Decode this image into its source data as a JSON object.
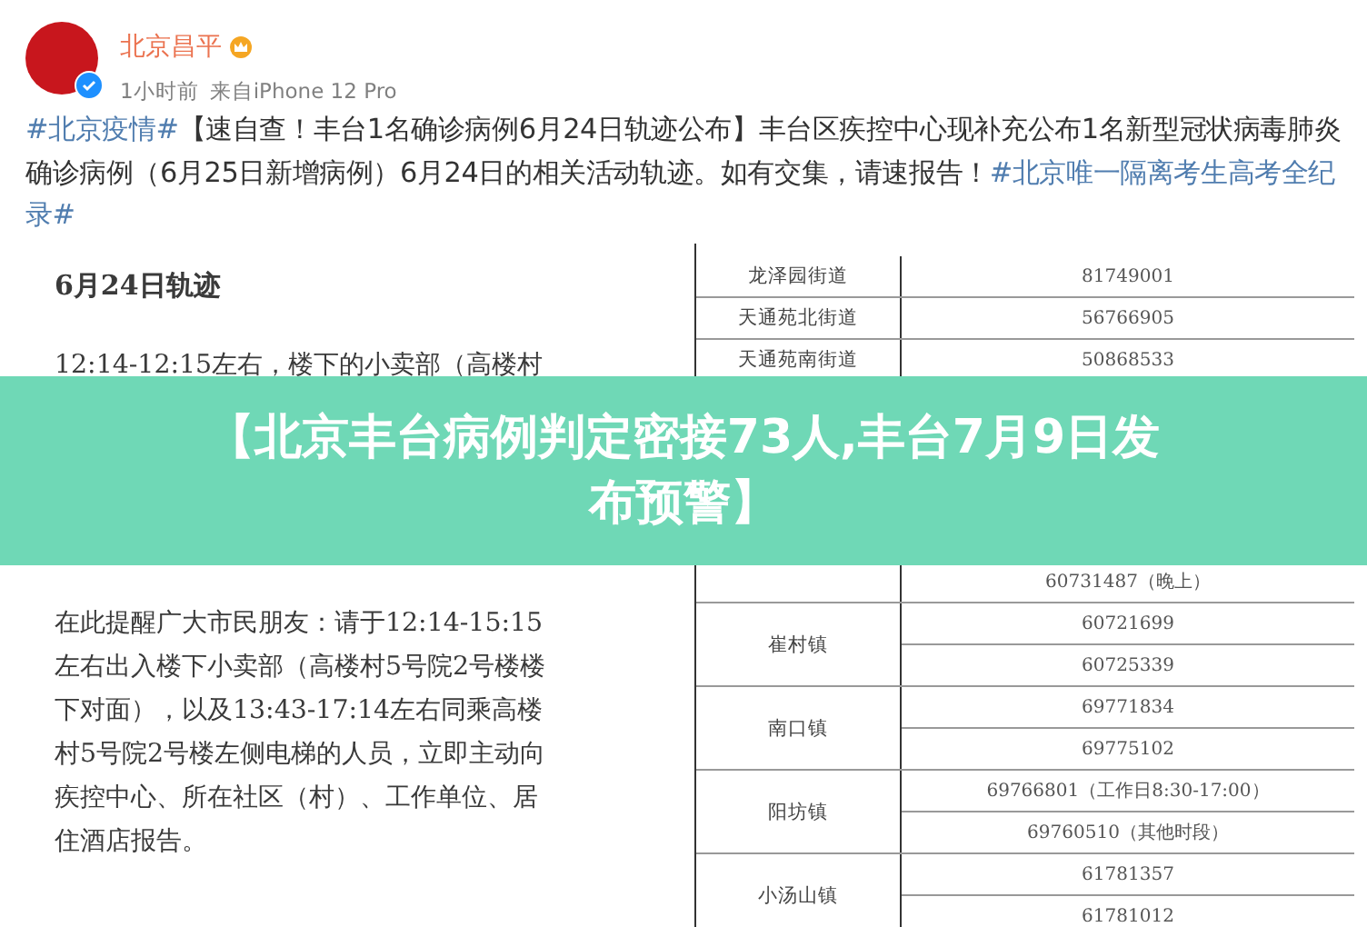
{
  "post": {
    "author": "北京昌平",
    "verified": true,
    "time": "1小时前",
    "source": "来自iPhone 12 Pro",
    "body": [
      {
        "kind": "tag",
        "text": "#北京疫情#"
      },
      {
        "kind": "text",
        "text": "【速自查！丰台1名确诊病例6月24日轨迹公布】丰台区疾控中心现补充公布1名新型冠状病毒肺炎确诊病例（6月25日新增病例）6月24日的相关活动轨迹。如有交集，请速报告！"
      },
      {
        "kind": "tag",
        "text": "#北京唯一隔离考生高考全纪录#"
      }
    ]
  },
  "document": {
    "title": "6月24日轨迹",
    "paragraphs": [
      [
        "12:14-12:15左右，楼下的小卖部（高楼村"
      ],
      [
        "在此提醒广大市民朋友：请于12:14-15:15",
        "左右出入楼下小卖部（高楼村5号院2号楼楼",
        "下对面），以及13:43-17:14左右同乘高楼",
        "村5号院2号楼左侧电梯的人员，立即主动向",
        "疾控中心、所在社区（村）、工作单位、居",
        "住酒店报告。"
      ]
    ]
  },
  "contacts": {
    "rows": [
      {
        "name": "龙泽园街道",
        "numbers": [
          "81749001"
        ]
      },
      {
        "name": "天通苑北街道",
        "numbers": [
          "56766905"
        ]
      },
      {
        "name": "天通苑南街道",
        "numbers": [
          "50868533"
        ]
      },
      {
        "numbers": [
          "60731487（晚上）"
        ]
      },
      {
        "name": "崔村镇",
        "numbers": [
          "60721699",
          "60725339"
        ]
      },
      {
        "name": "南口镇",
        "numbers": [
          "69771834",
          "69775102"
        ]
      },
      {
        "name": "阳坊镇",
        "numbers": [
          "69766801（工作日8:30-17:00）",
          "69760510（其他时段）"
        ]
      },
      {
        "name": "小汤山镇",
        "numbers": [
          "61781357",
          "61781012"
        ]
      }
    ]
  },
  "banner": {
    "lines": [
      "【北京丰台病例判定密接73人,丰台7月9日发",
      "布预警】"
    ]
  }
}
